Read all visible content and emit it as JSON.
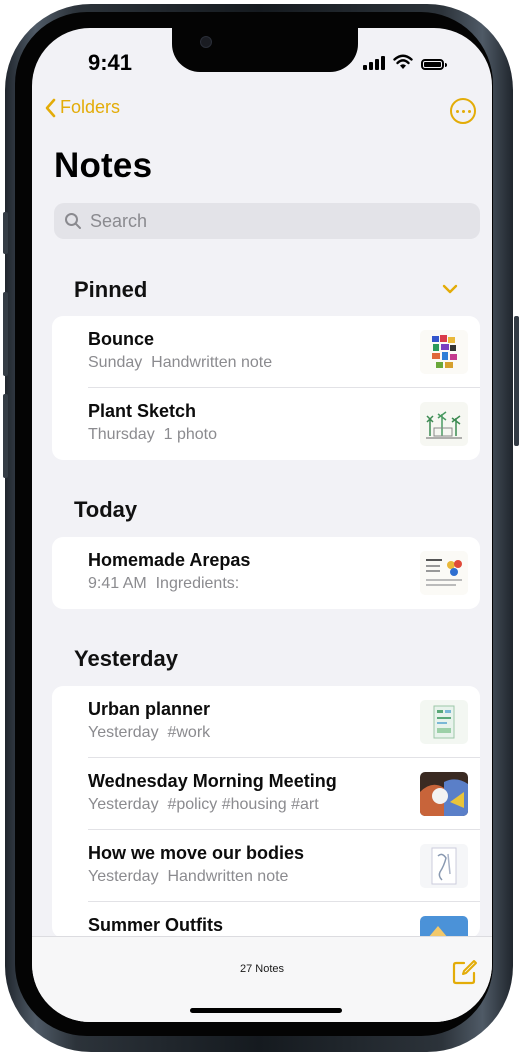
{
  "status_bar": {
    "time": "9:41"
  },
  "nav": {
    "back_label": "Folders",
    "more": "ellipsis-circle-icon"
  },
  "page_title": "Notes",
  "search": {
    "placeholder": "Search"
  },
  "sections": {
    "pinned": {
      "header": "Pinned",
      "notes": [
        {
          "title": "Bounce",
          "date": "Sunday",
          "preview": "Handwritten note"
        },
        {
          "title": "Plant Sketch",
          "date": "Thursday",
          "preview": "1 photo"
        }
      ]
    },
    "today": {
      "header": "Today",
      "notes": [
        {
          "title": "Homemade Arepas",
          "date": "9:41 AM",
          "preview": "Ingredients:"
        }
      ]
    },
    "yesterday": {
      "header": "Yesterday",
      "notes": [
        {
          "title": "Urban planner",
          "date": "Yesterday",
          "preview": "#work"
        },
        {
          "title": "Wednesday Morning Meeting",
          "date": "Yesterday",
          "preview": "#policy #housing #art"
        },
        {
          "title": "How we move our bodies",
          "date": "Yesterday",
          "preview": "Handwritten note"
        },
        {
          "title": "Summer Outfits",
          "date": "",
          "preview": ""
        }
      ]
    }
  },
  "toolbar": {
    "count_label": "27 Notes",
    "compose": "compose-icon"
  },
  "colors": {
    "accent": "#e3ac08",
    "background": "#f2f2f6",
    "card": "#ffffff",
    "secondary_text": "#8b8b8f"
  }
}
